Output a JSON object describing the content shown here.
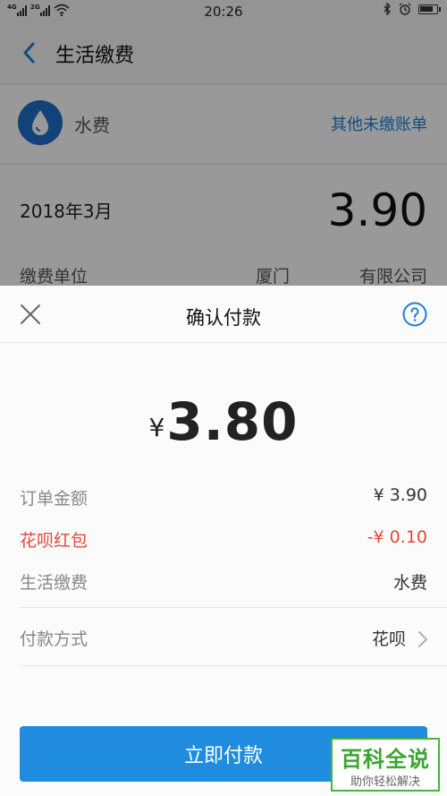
{
  "status_bar": {
    "time": "20:26",
    "signal1_label": "4G",
    "signal2_label": "2G"
  },
  "nav": {
    "title": "生活缴费"
  },
  "bill": {
    "name": "水费",
    "other_bills_link": "其他未缴账单",
    "month": "2018年3月",
    "amount": "3.90",
    "unit_label": "缴费单位",
    "unit_value_prefix": "厦门",
    "unit_value_suffix": "有限公司"
  },
  "sheet": {
    "title": "确认付款",
    "currency_symbol": "¥",
    "pay_amount": "3.80",
    "order_amount_label": "订单金额",
    "order_amount_value": "¥ 3.90",
    "red_packet_label": "花呗红包",
    "red_packet_value": "-¥ 0.10",
    "service_label": "生活缴费",
    "service_value": "水费",
    "payment_method_label": "付款方式",
    "payment_method_value": "花呗",
    "pay_button": "立即付款"
  },
  "watermark": {
    "top": "百科全说",
    "bottom": "助你轻松解决"
  },
  "colors": {
    "accent_blue": "#1f8ce0",
    "link_blue": "#1e7fd8",
    "discount_red": "#e2483d",
    "watermark_green": "#3aa52f"
  },
  "icons": [
    "back-arrow-icon",
    "water-drop-icon",
    "close-icon",
    "help-icon",
    "chevron-right-icon",
    "wifi-icon",
    "bluetooth-icon",
    "alarm-icon",
    "battery-icon"
  ]
}
